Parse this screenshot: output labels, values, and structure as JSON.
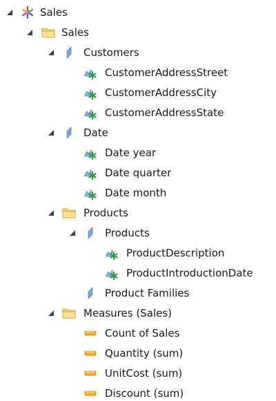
{
  "tree": {
    "root": {
      "label": "Sales",
      "icon": "cube-icon",
      "expanded": true
    },
    "sales_folder": {
      "label": "Sales",
      "icon": "folder-icon",
      "expanded": true
    },
    "customers": {
      "label": "Customers",
      "icon": "dimension-icon",
      "expanded": true,
      "attributes": [
        "CustomerAddressStreet",
        "CustomerAddressCity",
        "CustomerAddressState"
      ]
    },
    "date": {
      "label": "Date",
      "icon": "dimension-icon",
      "expanded": true,
      "attributes": [
        "Date year",
        "Date quarter",
        "Date month"
      ]
    },
    "products_folder": {
      "label": "Products",
      "icon": "folder-icon",
      "expanded": true
    },
    "products": {
      "label": "Products",
      "icon": "dimension-icon",
      "expanded": true,
      "attributes": [
        "ProductDescription",
        "ProductIntroductionDate"
      ]
    },
    "product_families": {
      "label": "Product Families",
      "icon": "dimension-icon"
    },
    "measures_folder": {
      "label": "Measures (Sales)",
      "icon": "folder-icon",
      "expanded": true,
      "measures": [
        "Count of Sales",
        "Quantity (sum)",
        "UnitCost (sum)",
        "Discount (sum)"
      ]
    }
  },
  "colors": {
    "toggle": "#404040",
    "folder": "#f2c94c",
    "dimension": "#7ba7dc",
    "attribute_star": "#2e9e45",
    "measure": "#f0a020"
  }
}
